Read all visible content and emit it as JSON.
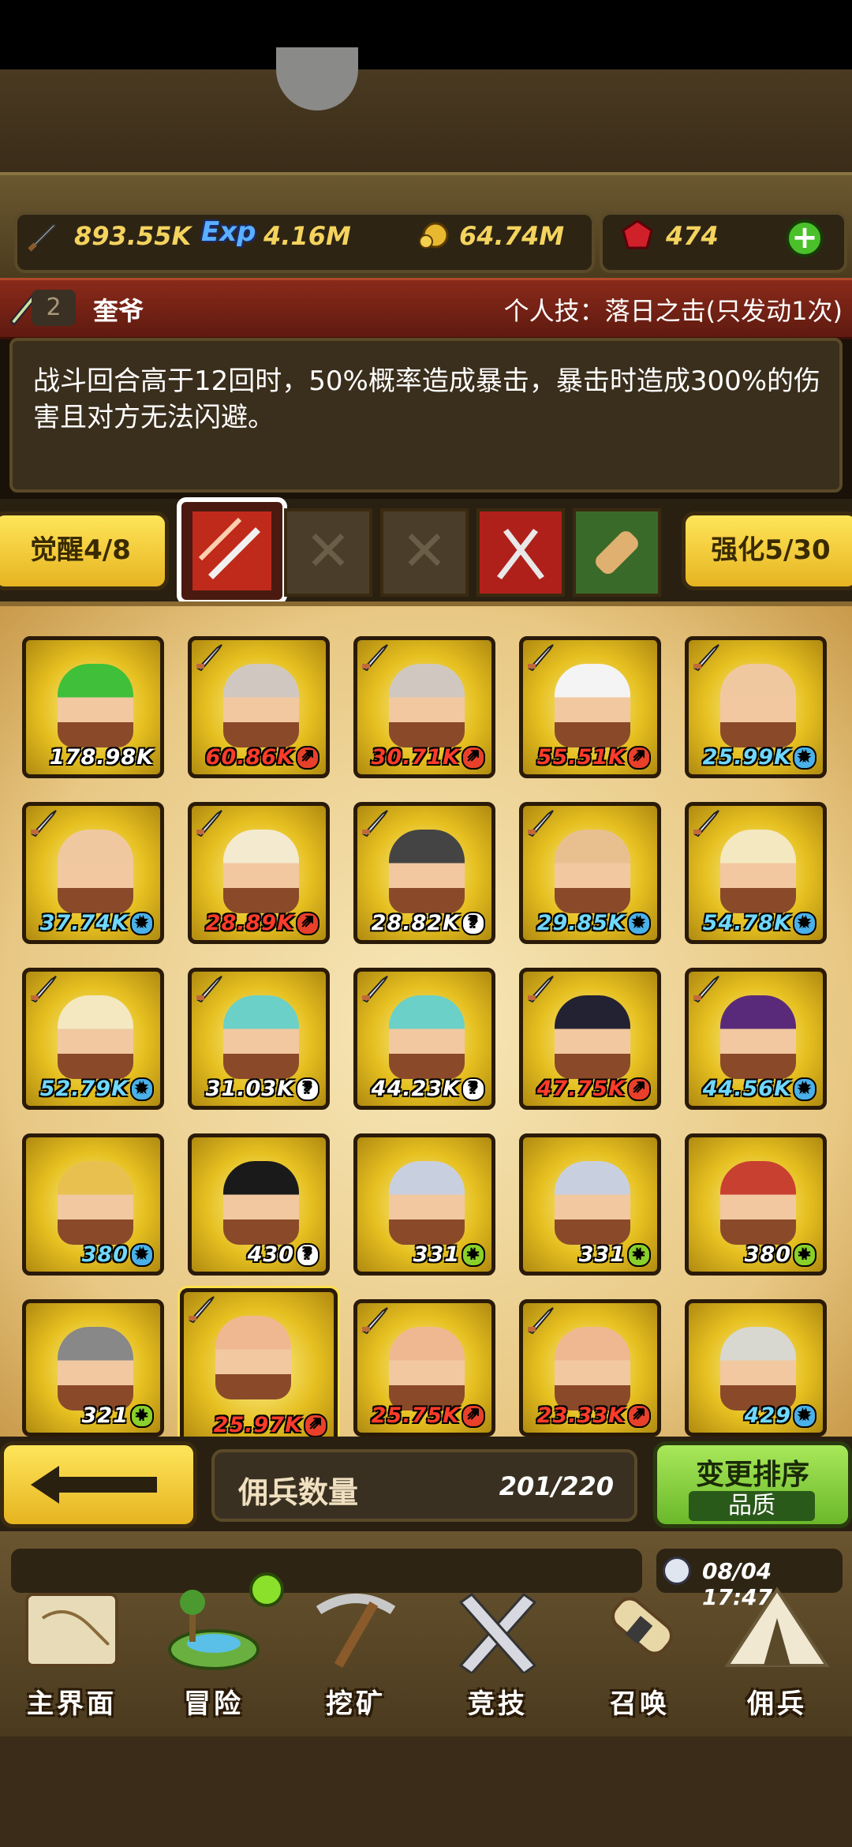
{
  "resources": {
    "attack": "893.55K",
    "exp_label": "Exp",
    "exp": "4.16M",
    "gold": "64.74M",
    "gems": "474"
  },
  "hero": {
    "rank": "2",
    "name": "奎爷",
    "skill_title": "个人技：落日之击(只发动1次)",
    "description": "战斗回合高于12回时，50%概率造成暴击，暴击时造成300%的伤害且对方无法闪避。"
  },
  "skills": {
    "awaken_label": "觉醒4/8",
    "enhance_label": "强化5/30"
  },
  "mercenaries": [
    {
      "power": "178.98K",
      "color": "white",
      "badge": "",
      "sword": false,
      "hair": "#3fbf3a"
    },
    {
      "power": "60.86K",
      "color": "red",
      "badge": "up",
      "sword": true,
      "hair": "#d0c8c0"
    },
    {
      "power": "30.71K",
      "color": "red",
      "badge": "up",
      "sword": true,
      "hair": "#d0c8c0"
    },
    {
      "power": "55.51K",
      "color": "red",
      "badge": "up",
      "sword": true,
      "hair": "#f4f4f4"
    },
    {
      "power": "25.99K",
      "color": "blue",
      "badge": "star",
      "sword": true,
      "hair": "#f0c8a0"
    },
    {
      "power": "37.74K",
      "color": "blue",
      "badge": "star",
      "sword": true,
      "hair": "#f0c8a0"
    },
    {
      "power": "28.89K",
      "color": "red",
      "badge": "up",
      "sword": true,
      "hair": "#f4ead0"
    },
    {
      "power": "28.82K",
      "color": "white",
      "badge": "?",
      "sword": true,
      "hair": "#444444"
    },
    {
      "power": "29.85K",
      "color": "blue",
      "badge": "star",
      "sword": true,
      "hair": "#e8c090"
    },
    {
      "power": "54.78K",
      "color": "blue",
      "badge": "star",
      "sword": true,
      "hair": "#f4e8c0"
    },
    {
      "power": "52.79K",
      "color": "blue",
      "badge": "star",
      "sword": true,
      "hair": "#f4e8c0"
    },
    {
      "power": "31.03K",
      "color": "white",
      "badge": "?",
      "sword": true,
      "hair": "#6ad0c8"
    },
    {
      "power": "44.23K",
      "color": "white",
      "badge": "?",
      "sword": true,
      "hair": "#6ad0c8"
    },
    {
      "power": "47.75K",
      "color": "red",
      "badge": "up",
      "sword": true,
      "hair": "#222233"
    },
    {
      "power": "44.56K",
      "color": "blue",
      "badge": "star",
      "sword": true,
      "hair": "#5a2a7a"
    },
    {
      "power": "380",
      "color": "blue",
      "badge": "star",
      "sword": false,
      "hair": "#e8c050"
    },
    {
      "power": "430",
      "color": "white",
      "badge": "?",
      "sword": false,
      "hair": "#1a1a1a"
    },
    {
      "power": "331",
      "color": "white",
      "badge": "plus",
      "sword": false,
      "hair": "#c8d0e0"
    },
    {
      "power": "331",
      "color": "white",
      "badge": "plus",
      "sword": false,
      "hair": "#c8d0e0"
    },
    {
      "power": "380",
      "color": "white",
      "badge": "plus",
      "sword": false,
      "hair": "#c84030"
    },
    {
      "power": "321",
      "color": "white",
      "badge": "plus",
      "sword": false,
      "hair": "#888888"
    },
    {
      "power": "25.97K",
      "color": "red",
      "badge": "up",
      "sword": true,
      "hair": "#f0b890"
    },
    {
      "power": "25.75K",
      "color": "red",
      "badge": "up",
      "sword": true,
      "hair": "#f0b890"
    },
    {
      "power": "23.33K",
      "color": "red",
      "badge": "up",
      "sword": true,
      "hair": "#f0b890"
    },
    {
      "power": "429",
      "color": "blue",
      "badge": "star",
      "sword": false,
      "hair": "#d8d8d0"
    }
  ],
  "bottom": {
    "count_label": "佣兵数量",
    "count_value": "201/220",
    "sort_label": "变更排序",
    "sort_mode": "品质"
  },
  "time": "08/04 17:47",
  "nav": [
    {
      "label": "主界面",
      "icon": "scroll-map-icon"
    },
    {
      "label": "冒险",
      "icon": "island-icon"
    },
    {
      "label": "挖矿",
      "icon": "pickaxe-icon"
    },
    {
      "label": "竞技",
      "icon": "crossed-swords-icon"
    },
    {
      "label": "召唤",
      "icon": "summon-scroll-icon"
    },
    {
      "label": "佣兵",
      "icon": "tent-icon"
    }
  ]
}
